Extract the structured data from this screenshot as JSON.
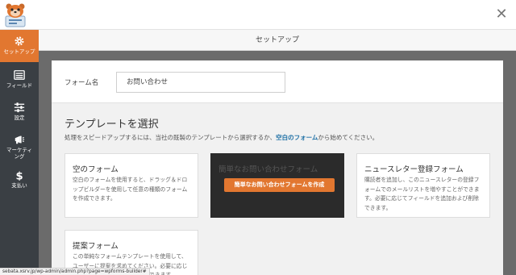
{
  "header": {
    "close_symbol": "✕"
  },
  "sidebar": {
    "items": [
      {
        "label": "セットアップ",
        "icon": "gear-icon",
        "active": true
      },
      {
        "label": "フィールド",
        "icon": "list-icon",
        "active": false
      },
      {
        "label": "設定",
        "icon": "sliders-icon",
        "active": false
      },
      {
        "label1": "マーケティ",
        "label2": "ング",
        "icon": "megaphone-icon",
        "active": false
      },
      {
        "label": "支払い",
        "icon": "dollar-icon",
        "active": false
      }
    ]
  },
  "section": {
    "title": "セットアップ"
  },
  "form_name": {
    "label": "フォーム名",
    "value": "お問い合わせ"
  },
  "templates": {
    "title": "テンプレートを選択",
    "desc_before": "処理をスピードアップするには、当社の既製のテンプレートから選択するか、",
    "desc_link": "空白のフォーム",
    "desc_after": "から始めてください。",
    "cards": [
      {
        "title": "空のフォーム",
        "desc": "空白のフォームを使用すると、ドラッグ＆ドロップビルダーを使用して任意の種類のフォームを作成できます。"
      },
      {
        "title": "簡単なお問い合わせフォーム",
        "button": "簡単なお問い合わせフォームを作成"
      },
      {
        "title": "ニュースレター登録フォーム",
        "desc": "購読者を追加し、このニュースレターの登録フォームでのメールリストを増やすことができます。必要に応じてフィールドを追加および削除できます。"
      },
      {
        "title": "提案フォーム",
        "desc": "この単純なフォームテンプレートを使用して、ユーザーに提案を求めてください。必要に応じてフィールドを追加および削除できます。"
      }
    ]
  },
  "statusbar": {
    "url": "sebata.xsrv.jp/wp-admin/admin.php?page=wpforms-builder#"
  },
  "colors": {
    "accent": "#e27730",
    "sidebar": "#3a3f44",
    "link": "#1d6fa5"
  }
}
